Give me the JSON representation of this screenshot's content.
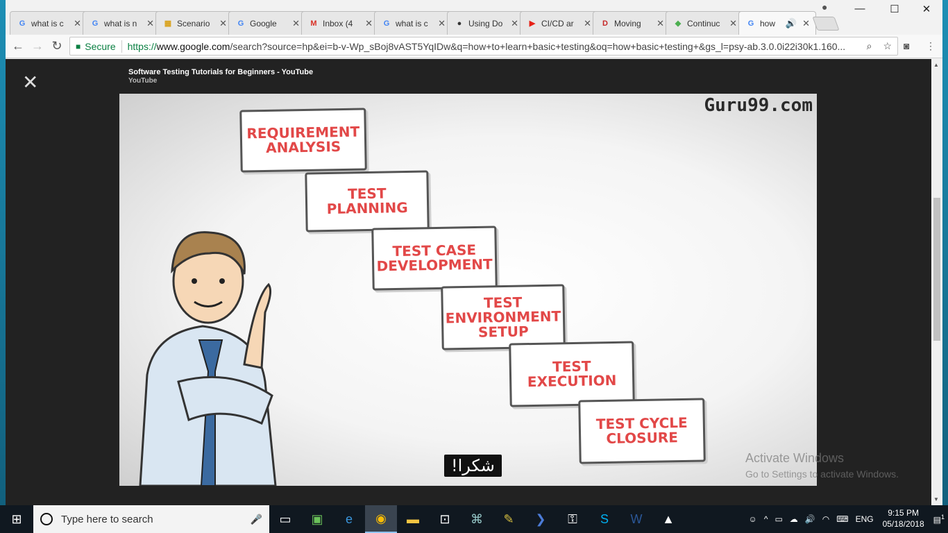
{
  "tabs": [
    {
      "label": "what is c",
      "favicon": "google-g"
    },
    {
      "label": "what is n",
      "favicon": "google-g"
    },
    {
      "label": "Scenario",
      "favicon": "doc-icon"
    },
    {
      "label": "Google",
      "favicon": "google-g"
    },
    {
      "label": "Inbox (4",
      "favicon": "gmail-icon"
    },
    {
      "label": "what is c",
      "favicon": "google-g"
    },
    {
      "label": "Using Do",
      "favicon": "github-icon"
    },
    {
      "label": "CI/CD ar",
      "favicon": "youtube-icon"
    },
    {
      "label": "Moving",
      "favicon": "d-icon"
    },
    {
      "label": "Continuc",
      "favicon": "leaf-icon"
    },
    {
      "label": "how",
      "favicon": "google-g"
    }
  ],
  "toolbar": {
    "secure_label": "Secure",
    "url_scheme": "https://",
    "url_host": "www.google.com",
    "url_path": "/search?source=hp&ei=b-v-Wp_sBoj8vAST5YqIDw&q=how+to+learn+basic+testing&oq=how+basic+testing+&gs_l=psy-ab.3.0.0i22i30k1.160..."
  },
  "viewer": {
    "title": "Software Testing Tutorials for Beginners - YouTube",
    "source": "YouTube"
  },
  "video": {
    "brand": "Guru99.com",
    "stages": [
      {
        "line1": "REQUIREMENT",
        "line2": "ANALYSIS"
      },
      {
        "line1": "TEST",
        "line2": "PLANNING"
      },
      {
        "line1": "TEST CASE",
        "line2": "DEVELOPMENT"
      },
      {
        "line1": "TEST",
        "line2": "ENVIRONMENT",
        "line3": "SETUP"
      },
      {
        "line1": "TEST",
        "line2": "EXECUTION"
      },
      {
        "line1": "TEST CYCLE",
        "line2": "CLOSURE"
      }
    ],
    "subtitle": "شكرا!"
  },
  "watermark": {
    "line1": "Activate Windows",
    "line2": "Go to Settings to activate Windows."
  },
  "taskbar": {
    "search_placeholder": "Type here to search",
    "language": "ENG",
    "time": "9:15 PM",
    "date": "05/18/2018",
    "notifications": "1"
  }
}
